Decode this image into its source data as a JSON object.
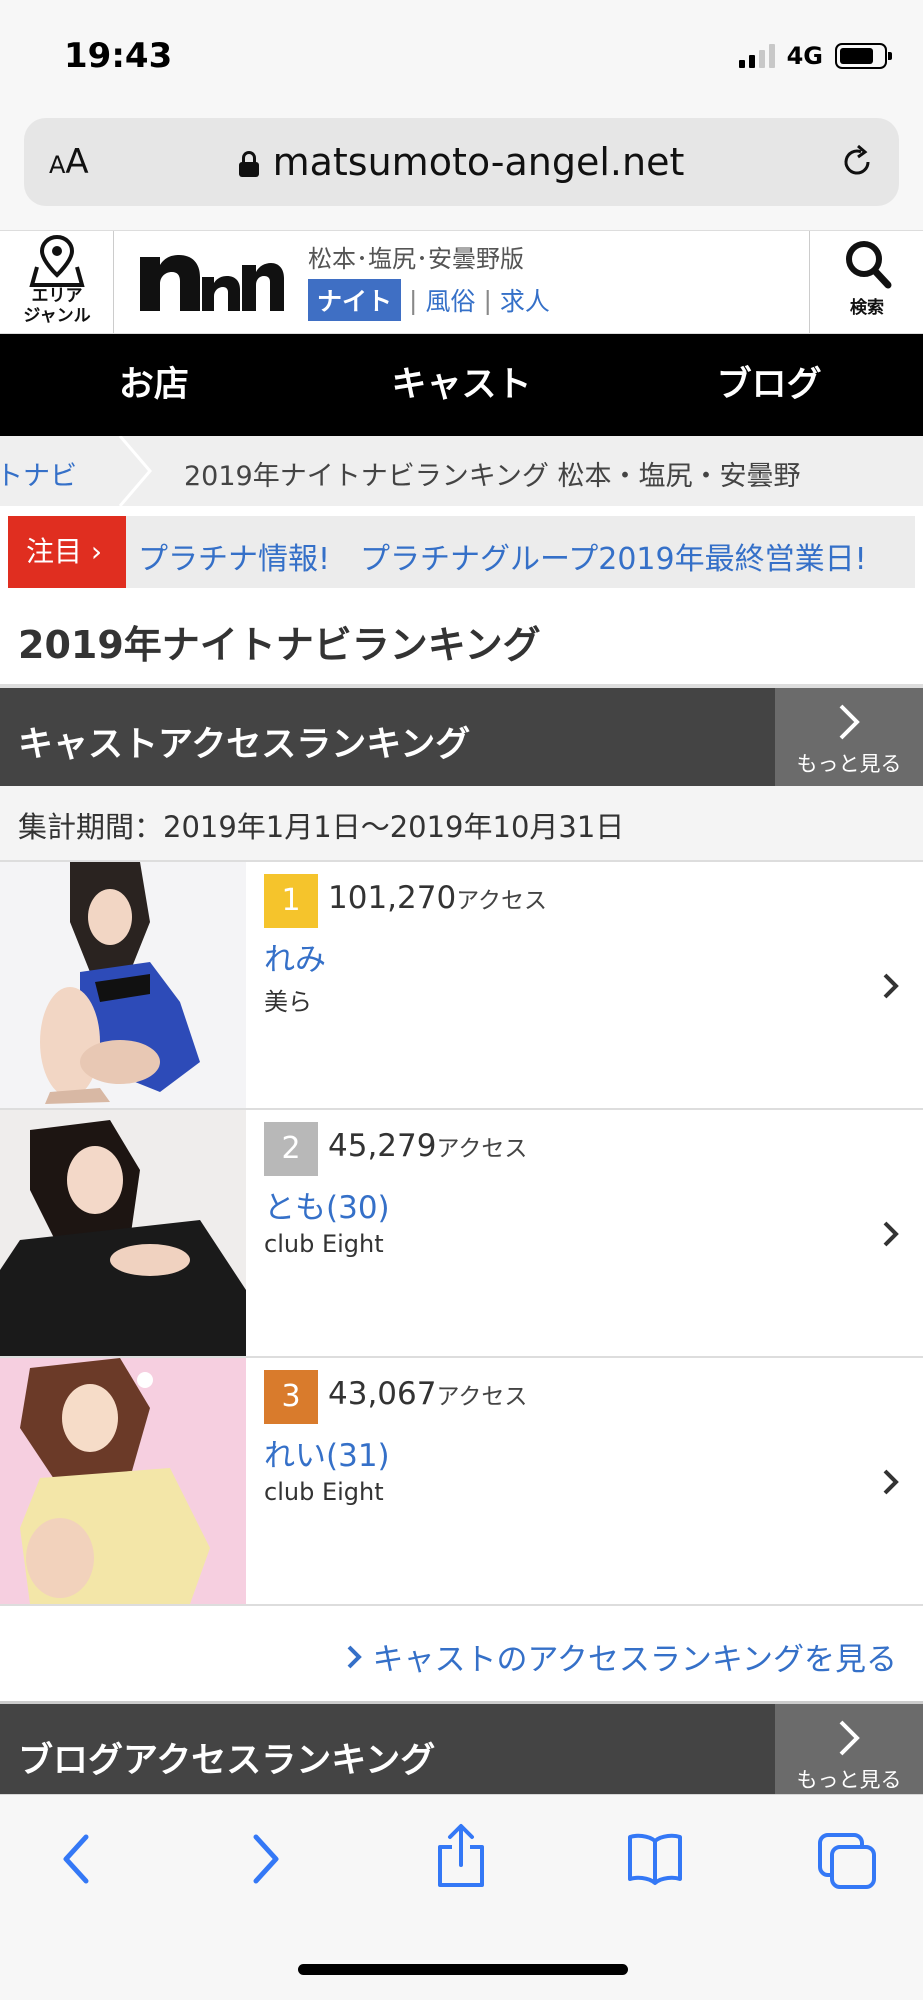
{
  "status_bar": {
    "time": "19:43",
    "network": "4G"
  },
  "browser": {
    "text_size_small": "A",
    "text_size_large": "A",
    "url": "matsumoto-angel.net"
  },
  "header": {
    "area_label_1": "エリア",
    "area_label_2": "ジャンル",
    "region": "松本･塩尻･安曇野版",
    "categories": {
      "active": "ナイト",
      "second": "風俗",
      "third": "求人"
    },
    "search_label": "検索"
  },
  "nav": {
    "items": [
      {
        "label": "お店"
      },
      {
        "label": "キャスト"
      },
      {
        "label": "ブログ"
      }
    ]
  },
  "breadcrumb": {
    "parent": "トナビ",
    "current": "2019年ナイトナビランキング 松本・塩尻・安曇野"
  },
  "notice": {
    "tag": "注目 ›",
    "text": "プラチナ情報!　プラチナグループ2019年最終営業日!"
  },
  "page_title": "2019年ナイトナビランキング",
  "cast_ranking": {
    "title": "キャストアクセスランキング",
    "more_label": "もっと見る",
    "period": "集計期間：2019年1月1日〜2019年10月31日",
    "items": [
      {
        "rank": "1",
        "count": "101,270",
        "unit": "アクセス",
        "name": "れみ",
        "shop": "美ら",
        "badge_color": "#f5c42c"
      },
      {
        "rank": "2",
        "count": "45,279",
        "unit": "アクセス",
        "name": "とも(30)",
        "shop": "club Eight",
        "badge_color": "#b8b8b8"
      },
      {
        "rank": "3",
        "count": "43,067",
        "unit": "アクセス",
        "name": "れい(31)",
        "shop": "club Eight",
        "badge_color": "#d97b2c"
      }
    ],
    "see_more": "キャストのアクセスランキングを見る"
  },
  "blog_ranking": {
    "title": "ブログアクセスランキング",
    "more_label": "もっと見る"
  }
}
